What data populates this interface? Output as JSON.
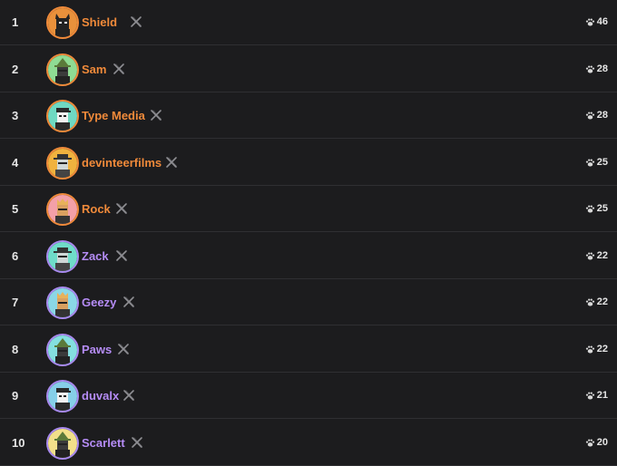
{
  "colors": {
    "background": "#1c1c1e",
    "divider": "#2f2f32",
    "name_orange": "#f08a3a",
    "name_purple": "#b58cf5",
    "ring_orange": "#f08a3a",
    "ring_purple": "#a98af0"
  },
  "entries": [
    {
      "rank": "1",
      "name": "Shield",
      "score": "46",
      "tier": "orange",
      "avatar_bg": "#e9913b",
      "avatar_char": "cat"
    },
    {
      "rank": "2",
      "name": "Sam",
      "score": "28",
      "tier": "orange",
      "avatar_bg": "#8fdc93",
      "avatar_char": "wizard"
    },
    {
      "rank": "3",
      "name": "Type Media",
      "score": "28",
      "tier": "orange",
      "avatar_bg": "#6fd9c2",
      "avatar_char": "cap"
    },
    {
      "rank": "4",
      "name": "devinteerfilms",
      "score": "25",
      "tier": "orange",
      "avatar_bg": "#f0b23e",
      "avatar_char": "hat"
    },
    {
      "rank": "5",
      "name": "Rock",
      "score": "25",
      "tier": "orange",
      "avatar_bg": "#f3a0a8",
      "avatar_char": "crown"
    },
    {
      "rank": "6",
      "name": "Zack",
      "score": "22",
      "tier": "purple",
      "avatar_bg": "#6fdcc9",
      "avatar_char": "hat"
    },
    {
      "rank": "7",
      "name": "Geezy",
      "score": "22",
      "tier": "purple",
      "avatar_bg": "#8ad7e6",
      "avatar_char": "crown"
    },
    {
      "rank": "8",
      "name": "Paws",
      "score": "22",
      "tier": "purple",
      "avatar_bg": "#84dfe0",
      "avatar_char": "wizard"
    },
    {
      "rank": "9",
      "name": "duvalx",
      "score": "21",
      "tier": "purple",
      "avatar_bg": "#86cfe8",
      "avatar_char": "cap"
    },
    {
      "rank": "10",
      "name": "Scarlett",
      "score": "20",
      "tier": "purple",
      "avatar_bg": "#f2e08a",
      "avatar_char": "wizard"
    }
  ]
}
